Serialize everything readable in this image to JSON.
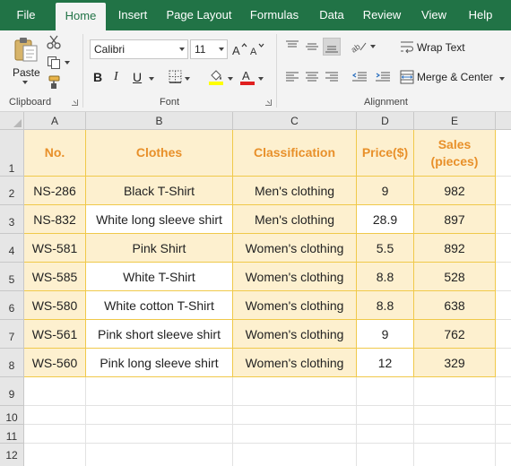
{
  "tabs": [
    {
      "label": "File"
    },
    {
      "label": "Home"
    },
    {
      "label": "Insert"
    },
    {
      "label": "Page Layout"
    },
    {
      "label": "Formulas"
    },
    {
      "label": "Data"
    },
    {
      "label": "Review"
    },
    {
      "label": "View"
    },
    {
      "label": "Help"
    }
  ],
  "ribbon": {
    "clipboard": {
      "paste_label": "Paste",
      "group_label": "Clipboard"
    },
    "font": {
      "font_name": "Calibri",
      "font_size": "11",
      "group_label": "Font"
    },
    "alignment": {
      "wrap_text": "Wrap Text",
      "merge_center": "Merge & Center",
      "group_label": "Alignment"
    }
  },
  "sheet": {
    "columns": [
      "A",
      "B",
      "C",
      "D",
      "E"
    ],
    "rows": [
      "1",
      "2",
      "3",
      "4",
      "5",
      "6",
      "7",
      "8",
      "9",
      "10",
      "11",
      "12"
    ],
    "header": [
      "No.",
      "Clothes",
      "Classification",
      "Price($)",
      "Sales (pieces)"
    ],
    "data": [
      [
        "NS-286",
        "Black T-Shirt",
        "Men's clothing",
        "9",
        "982"
      ],
      [
        "NS-832",
        "White long sleeve shirt",
        "Men's clothing",
        "28.9",
        "897"
      ],
      [
        "WS-581",
        "Pink Shirt",
        "Women's clothing",
        "5.5",
        "892"
      ],
      [
        "WS-585",
        "White T-Shirt",
        "Women's clothing",
        "8.8",
        "528"
      ],
      [
        "WS-580",
        "White cotton T-Shirt",
        "Women's clothing",
        "8.8",
        "638"
      ],
      [
        "WS-561",
        "Pink short sleeve shirt",
        "Women's clothing",
        "9",
        "762"
      ],
      [
        "WS-560",
        "Pink long sleeve shirt",
        "Women's clothing",
        "12",
        "329"
      ]
    ],
    "accent_colors": {
      "ribbon_green": "#217346",
      "header_text": "#e8902a",
      "cell_fill": "#fdf0cf",
      "cell_border": "#f0c94a"
    }
  }
}
